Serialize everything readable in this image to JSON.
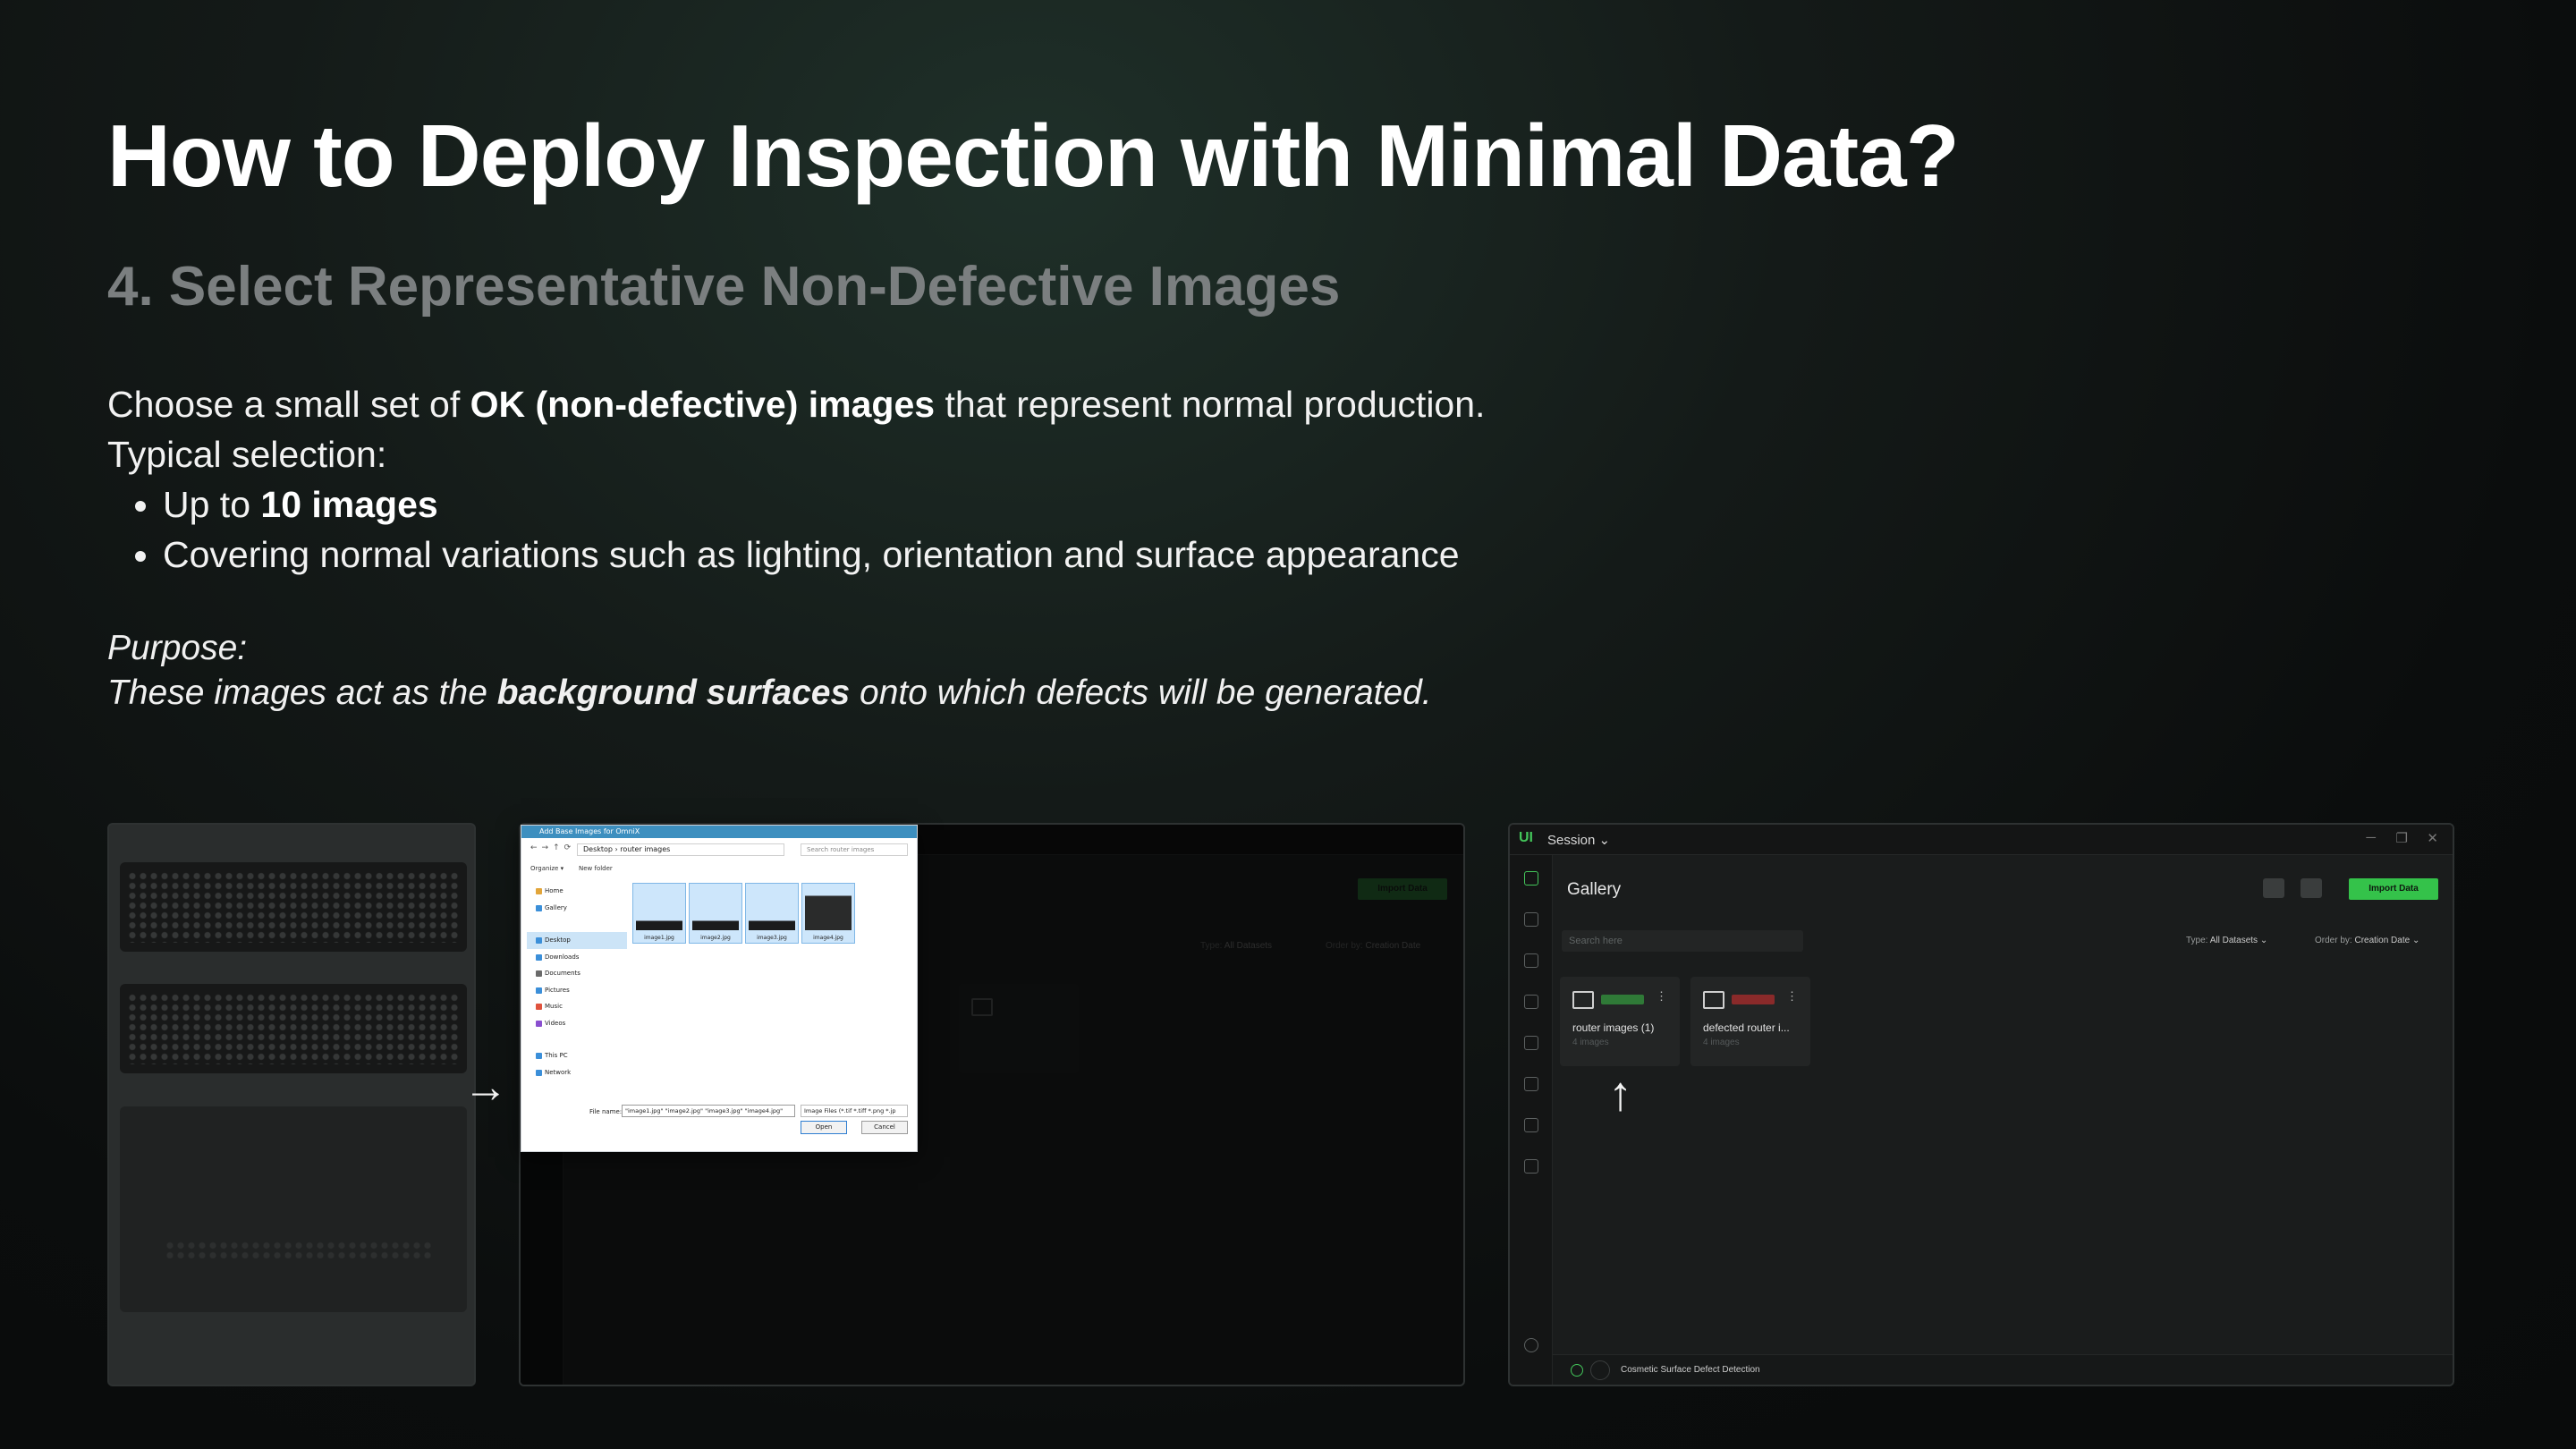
{
  "slide": {
    "title": "How to Deploy Inspection with Minimal Data?",
    "subtitle": "4. Select Representative Non-Defective Images",
    "intro_pre": "Choose a small set of ",
    "intro_bold": "OK (non-defective) images",
    "intro_post": " that represent normal production.",
    "typical": "Typical selection:",
    "bullet1_pre": "Up to ",
    "bullet1_bold": "10 images",
    "bullet2": "Covering normal variations such as lighting, orientation and surface appearance",
    "purpose_label": "Purpose:",
    "purpose_pre": "These images act as the ",
    "purpose_bold": "background surfaces",
    "purpose_post": " onto which defects will be generated."
  },
  "arrows": {
    "right": "→",
    "up": "↑"
  },
  "file_dialog": {
    "title": "Add Base Images for OmniX",
    "address": "Desktop  ›  router images",
    "search_placeholder": "Search router images",
    "organize": "Organize ▾",
    "new_folder": "New folder",
    "sidebar": [
      "Home",
      "Gallery",
      "Desktop",
      "Downloads",
      "Documents",
      "Pictures",
      "Music",
      "Videos",
      "This PC",
      "Network"
    ],
    "files": [
      "image1.jpg",
      "image2.jpg",
      "image3.jpg",
      "image4.jpg"
    ],
    "file_name_label": "File name:",
    "file_name_value": "\"image1.jpg\" \"image2.jpg\" \"image3.jpg\" \"image4.jpg\"",
    "file_type": "Image Files (*.tif *.tiff *.png *.jp",
    "open": "Open",
    "cancel": "Cancel"
  },
  "app": {
    "logo": "UI",
    "session": "Session",
    "session_caret": "⌄",
    "page_title": "Gallery",
    "import_button": "Import Data",
    "search_placeholder": "Search here",
    "type_label": "Type:",
    "type_value": "All Datasets",
    "order_label": "Order by:",
    "order_value": "Creation Date",
    "datasets": [
      {
        "name": "router images (1)",
        "count": "4 images",
        "tag_color": "#2f7a37"
      },
      {
        "name": "defected router i...",
        "count": "4 images",
        "tag_color": "#8a2a2a"
      }
    ],
    "status_text": "Cosmetic Surface Defect Detection",
    "minimize": "─",
    "restore": "❐",
    "close": "✕",
    "more": "⋮",
    "accent": "#34c24a"
  }
}
